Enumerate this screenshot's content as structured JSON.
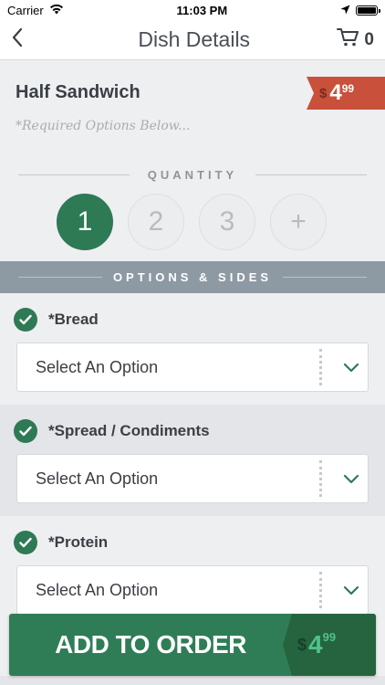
{
  "status": {
    "carrier": "Carrier",
    "time": "11:03 PM"
  },
  "nav": {
    "title": "Dish Details",
    "cart_count": "0"
  },
  "dish": {
    "name": "Half Sandwich",
    "required_note": "*Required Options Below...",
    "price": {
      "currency": "$",
      "main": "4",
      "cents": "99"
    }
  },
  "quantity": {
    "label": "QUANTITY",
    "options": [
      "1",
      "2",
      "3",
      "+"
    ],
    "selected": "1"
  },
  "options_header": "OPTIONS & SIDES",
  "options": [
    {
      "title": "*Bread",
      "value": "Select An Option"
    },
    {
      "title": "*Spread / Condiments",
      "value": "Select An Option"
    },
    {
      "title": "*Protein",
      "value": "Select An Option"
    }
  ],
  "add_to_order": {
    "label": "ADD TO ORDER",
    "price": {
      "currency": "$",
      "main": "4",
      "cents": "99"
    }
  },
  "colors": {
    "accent_green": "#2d7a55",
    "price_red": "#c9503a",
    "band_gray": "#8d9aa4"
  }
}
